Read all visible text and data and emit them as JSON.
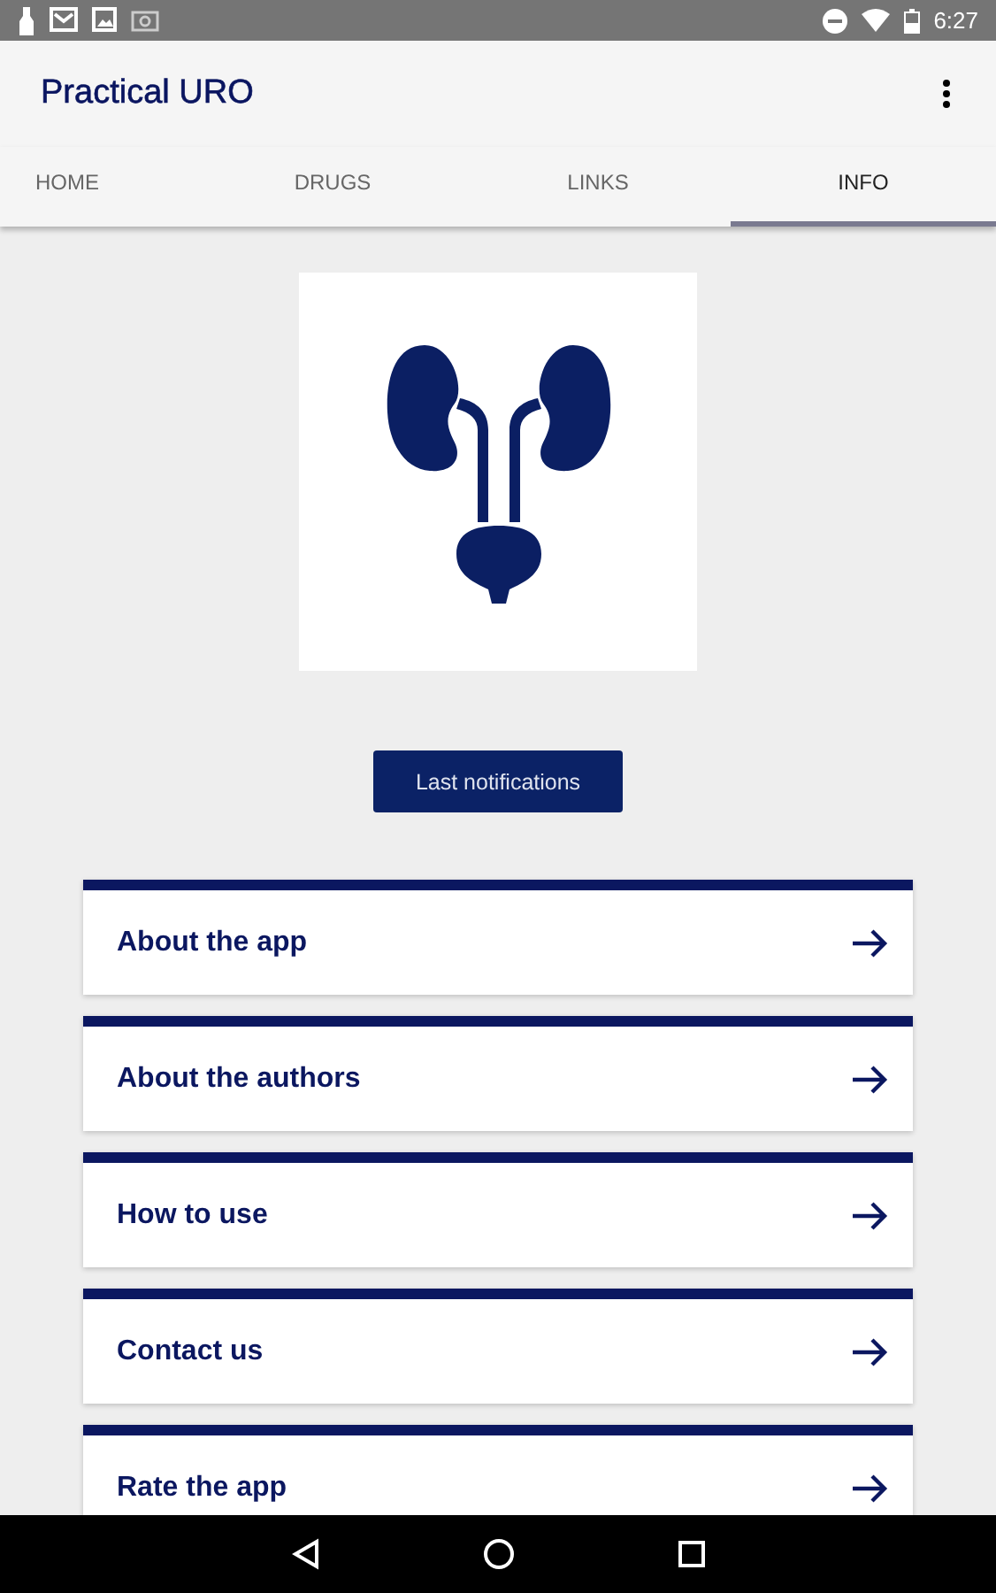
{
  "status_bar": {
    "time": "6:27"
  },
  "app_bar": {
    "title": "Practical URO"
  },
  "tabs": [
    {
      "label": "HOME",
      "selected": false
    },
    {
      "label": "DRUGS",
      "selected": false
    },
    {
      "label": "LINKS",
      "selected": false
    },
    {
      "label": "INFO",
      "selected": true
    }
  ],
  "notifications_button": {
    "label": "Last notifications"
  },
  "info_items": [
    {
      "label": "About the app"
    },
    {
      "label": "About the authors"
    },
    {
      "label": "How to use"
    },
    {
      "label": "Contact us"
    },
    {
      "label": "Rate the app"
    }
  ]
}
